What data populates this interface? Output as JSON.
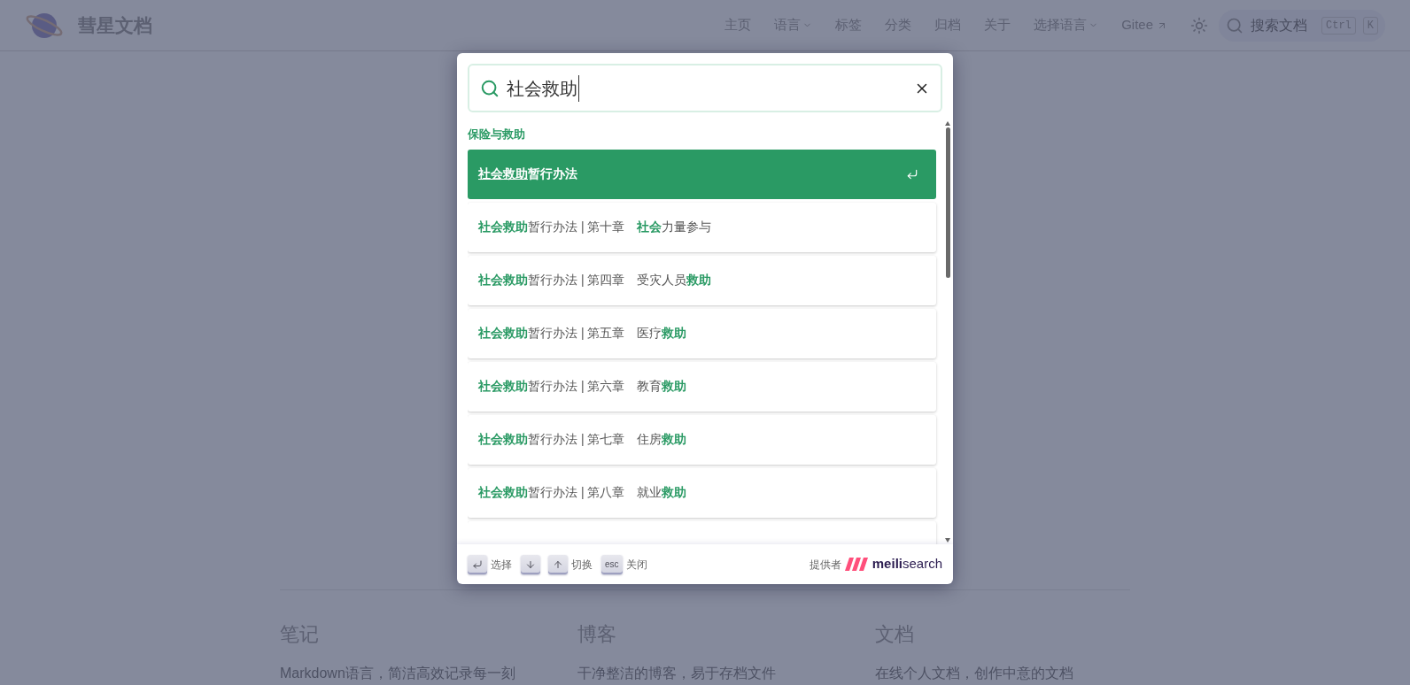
{
  "header": {
    "site_title": "彗星文档",
    "nav": [
      {
        "label": "主页",
        "dropdown": false,
        "external": false
      },
      {
        "label": "语言",
        "dropdown": true,
        "external": false
      },
      {
        "label": "标签",
        "dropdown": false,
        "external": false
      },
      {
        "label": "分类",
        "dropdown": false,
        "external": false
      },
      {
        "label": "归档",
        "dropdown": false,
        "external": false
      },
      {
        "label": "关于",
        "dropdown": false,
        "external": false
      },
      {
        "label": "选择语言",
        "dropdown": true,
        "external": false
      },
      {
        "label": "Gitee",
        "dropdown": false,
        "external": true
      }
    ],
    "search": {
      "placeholder": "搜索文档",
      "keys": [
        "Ctrl",
        "K"
      ]
    }
  },
  "features": [
    {
      "title": "笔记",
      "text": "Markdown语言，简洁高效记录每一刻"
    },
    {
      "title": "博客",
      "text": "干净整洁的博客，易于存档文件"
    },
    {
      "title": "文档",
      "text": "在线个人文档，创作中意的文档"
    }
  ],
  "search_modal": {
    "query": "社会救助",
    "group": "保险与救助",
    "results": [
      {
        "title": "**社会救助**暂行办法",
        "selected": true
      },
      {
        "title": "**社会救助**暂行办法 | 第十章　**社会**力量参与",
        "selected": false
      },
      {
        "title": "**社会救助**暂行办法 | 第四章　受灾人员**救助**",
        "selected": false
      },
      {
        "title": "**社会救助**暂行办法 | 第五章　医疗**救助**",
        "selected": false
      },
      {
        "title": "**社会救助**暂行办法 | 第六章　教育**救助**",
        "selected": false
      },
      {
        "title": "**社会救助**暂行办法 | 第七章　住房**救助**",
        "selected": false
      },
      {
        "title": "**社会救助**暂行办法 | 第八章　就业**救助**",
        "selected": false
      }
    ],
    "footer": {
      "hints": [
        {
          "kind": "enter",
          "label": "选择"
        },
        {
          "kind": "arrows",
          "label": "切换"
        },
        {
          "kind": "esc",
          "key": "esc",
          "label": "关闭"
        }
      ],
      "provider_label": "提供者",
      "brand_bold": "meili",
      "brand_rest": "search"
    }
  }
}
